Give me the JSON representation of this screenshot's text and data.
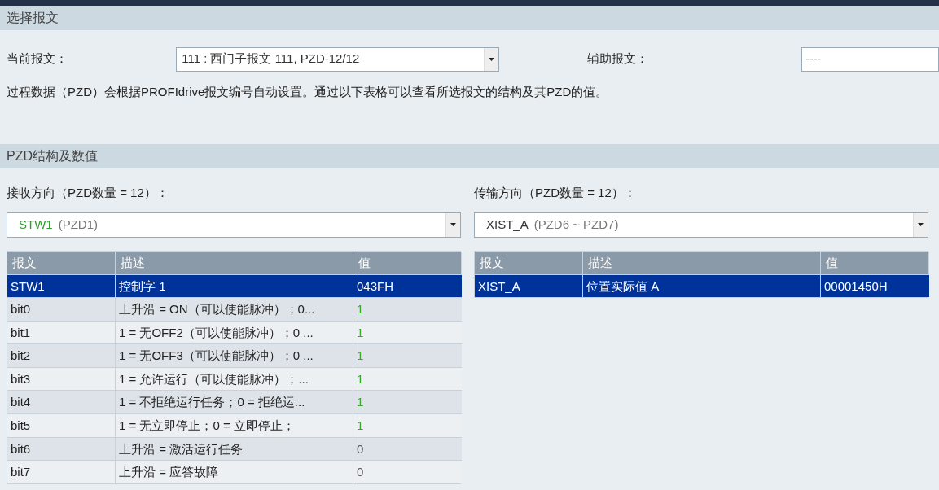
{
  "sections": [
    {
      "title": "选择报文"
    },
    {
      "title": "PZD结构及数值"
    }
  ],
  "current_telegram": {
    "label": "当前报文：",
    "value": "111 : 西门子报文 111, PZD-12/12"
  },
  "aux_telegram": {
    "label": "辅助报文：",
    "value": "----"
  },
  "description": "过程数据（PZD）会根据PROFIdrive报文编号自动设置。通过以下表格可以查看所选报文的结构及其PZD的值。",
  "panels": [
    {
      "label": "接收方向（PZD数量 = 12）：",
      "select": {
        "name": "STW1",
        "range": "(PZD1)",
        "highlighted": true
      },
      "columns": [
        "报文",
        "描述",
        "值"
      ],
      "rows": [
        {
          "telegram": "STW1",
          "description": "控制字 1",
          "value": "043FH",
          "selected": true
        },
        {
          "telegram": "bit0",
          "description": "上升沿 = ON（可以使能脉冲）；0...",
          "value": "1",
          "selected": false,
          "on": true
        },
        {
          "telegram": "bit1",
          "description": "1 = 无OFF2（可以使能脉冲）；0 ...",
          "value": "1",
          "selected": false,
          "on": true
        },
        {
          "telegram": "bit2",
          "description": "1 = 无OFF3（可以使能脉冲）；0 ...",
          "value": "1",
          "selected": false,
          "on": true
        },
        {
          "telegram": "bit3",
          "description": "1 = 允许运行（可以使能脉冲）；...",
          "value": "1",
          "selected": false,
          "on": true
        },
        {
          "telegram": "bit4",
          "description": "1 = 不拒绝运行任务；0 = 拒绝运...",
          "value": "1",
          "selected": false,
          "on": true
        },
        {
          "telegram": "bit5",
          "description": "1 = 无立即停止；0 = 立即停止；",
          "value": "1",
          "selected": false,
          "on": true
        },
        {
          "telegram": "bit6",
          "description": "上升沿 = 激活运行任务",
          "value": "0",
          "selected": false,
          "on": false
        },
        {
          "telegram": "bit7",
          "description": "上升沿 = 应答故障",
          "value": "0",
          "selected": false,
          "on": false
        }
      ]
    },
    {
      "label": "传输方向（PZD数量 = 12）：",
      "select": {
        "name": "XIST_A",
        "range": "(PZD6 ~ PZD7)",
        "highlighted": false
      },
      "columns": [
        "报文",
        "描述",
        "值"
      ],
      "rows": [
        {
          "telegram": "XIST_A",
          "description": "位置实际值 A",
          "value": "00001450H",
          "selected": true
        }
      ]
    }
  ]
}
